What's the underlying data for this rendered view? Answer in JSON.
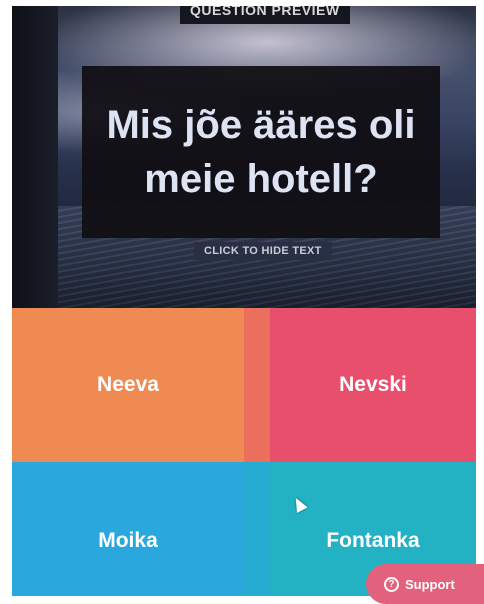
{
  "preview": {
    "badge": "QUESTION PREVIEW",
    "question": "Mis jõe ääres oli meie hotell?",
    "hide_text_label": "CLICK TO HIDE TEXT"
  },
  "answers": [
    {
      "label": "Neeva",
      "color": "#ee8a52"
    },
    {
      "label": "Nevski",
      "color": "#e74f6d"
    },
    {
      "label": "Moika",
      "color": "#2aa8de"
    },
    {
      "label": "Fontanka",
      "color": "#22b2c4"
    }
  ],
  "support": {
    "label": "Support",
    "icon": "question-circle-icon",
    "color": "#e2617c"
  }
}
